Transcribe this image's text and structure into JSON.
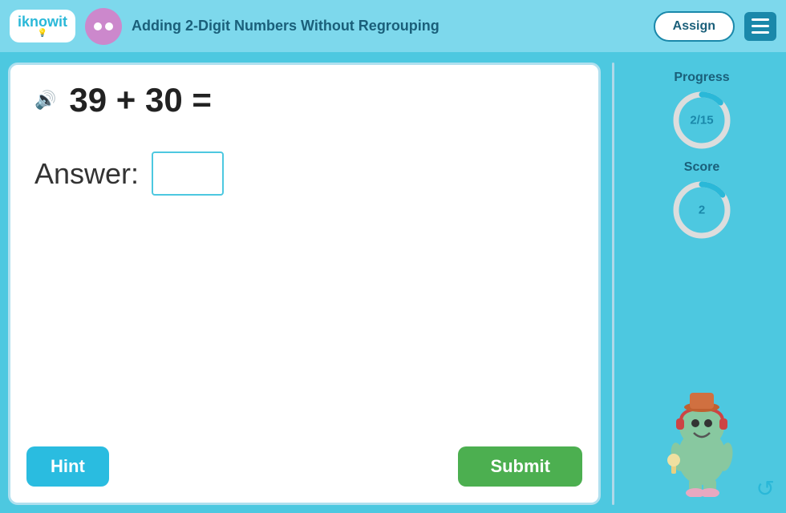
{
  "header": {
    "logo": "iknowit",
    "lesson_title": "Adding 2-Digit Numbers Without Regrouping",
    "assign_label": "Assign",
    "menu_aria": "Menu"
  },
  "question": {
    "text": "39 + 30 =",
    "answer_label": "Answer:",
    "answer_placeholder": ""
  },
  "buttons": {
    "hint": "Hint",
    "submit": "Submit"
  },
  "sidebar": {
    "progress_label": "Progress",
    "progress_value": "2/15",
    "progress_percent": 13,
    "score_label": "Score",
    "score_value": "2",
    "score_percent": 15
  },
  "icons": {
    "speaker": "🔊",
    "nav_arrow": "⊙"
  }
}
